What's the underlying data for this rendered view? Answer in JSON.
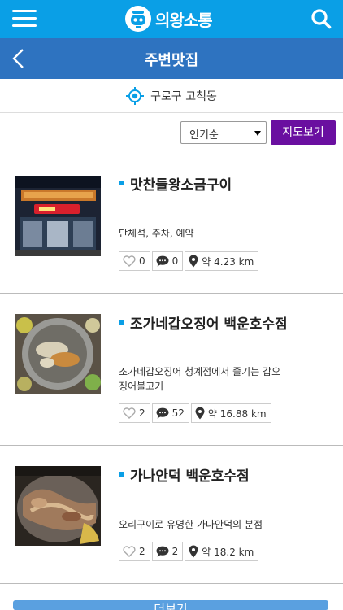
{
  "header": {
    "logo_text": "의왕소통",
    "menu_icon": "hamburger-menu-icon",
    "search_icon": "search-icon",
    "accent_color": "#0a9fe6"
  },
  "subheader": {
    "title": "주변맛집",
    "back_icon": "chevron-left-icon",
    "color": "#2e73c0"
  },
  "location": {
    "icon": "location-target-icon",
    "text": "구로구 고척동"
  },
  "filter": {
    "sort_selected": "인기순",
    "map_button": "지도보기",
    "map_button_color": "#6a0fa0"
  },
  "restaurants": [
    {
      "name": "맛찬들왕소금구이",
      "description": "단체석, 주차, 예약",
      "likes": "0",
      "comments": "0",
      "distance": "약 4.23 km"
    },
    {
      "name": "조가네갑오징어 백운호수점",
      "description": "조가네갑오징어 청계점에서 즐기는 갑오징어불고기",
      "likes": "2",
      "comments": "52",
      "distance": "약 16.88 km"
    },
    {
      "name": "가나안덕 백운호수점",
      "description": "오리구이로 유명한 가나안덕의 분점",
      "likes": "2",
      "comments": "2",
      "distance": "약 18.2 km"
    }
  ],
  "more_button": "더보기"
}
